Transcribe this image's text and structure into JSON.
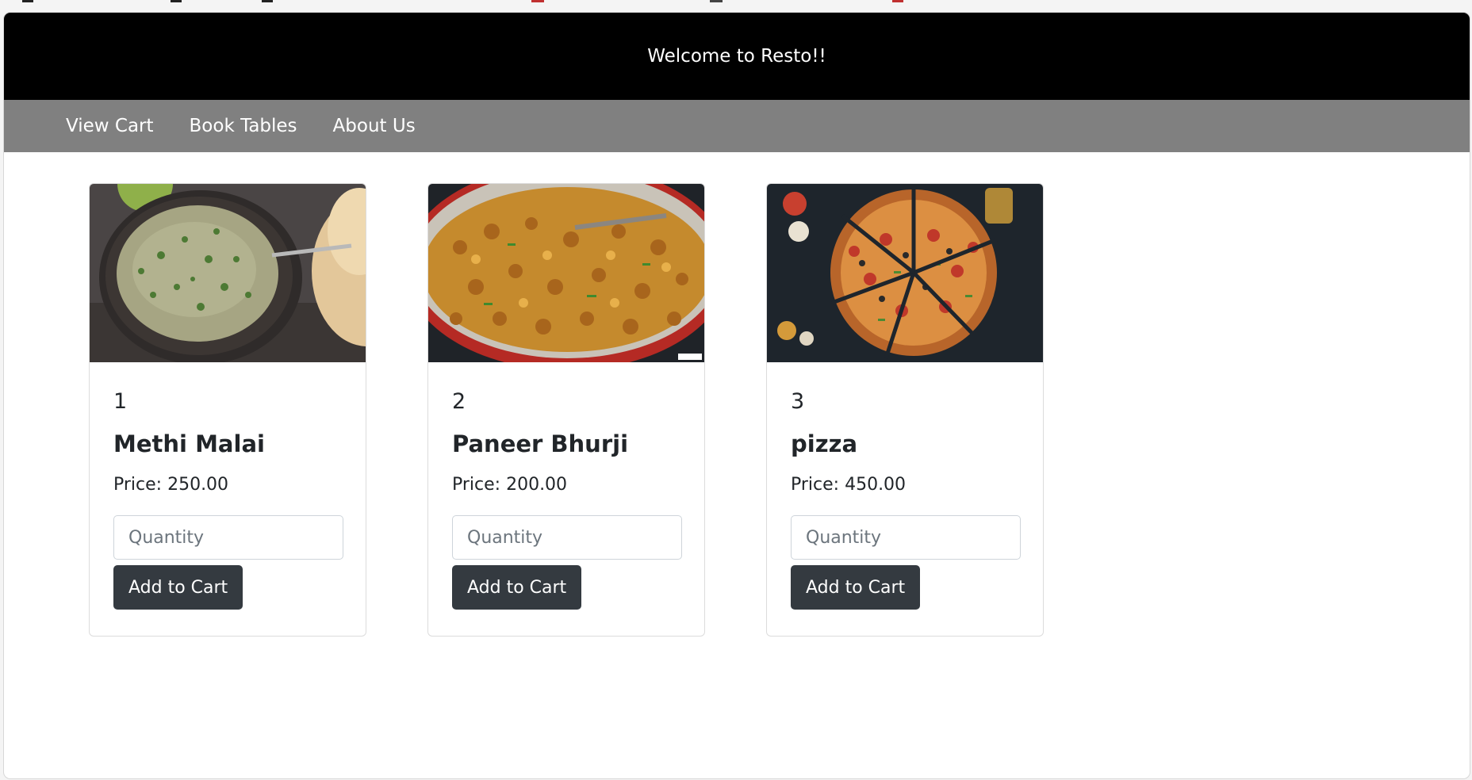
{
  "header": {
    "title": "Welcome to Resto!!",
    "background": "#000000"
  },
  "nav": {
    "items": [
      {
        "label": "View Cart"
      },
      {
        "label": "Book Tables"
      },
      {
        "label": "About Us"
      }
    ],
    "background": "#808080"
  },
  "menu": {
    "quantity_placeholder": "Quantity",
    "add_to_cart_label": "Add to Cart",
    "items": [
      {
        "id": "1",
        "name": "Methi Malai",
        "price": "Price: 250.00",
        "image": "methi-malai-dish"
      },
      {
        "id": "2",
        "name": "Paneer Bhurji",
        "price": "Price: 200.00",
        "image": "paneer-bhurji-dish"
      },
      {
        "id": "3",
        "name": "pizza",
        "price": "Price: 450.00",
        "image": "pizza-dish"
      }
    ]
  },
  "colors": {
    "button": "#343a40",
    "text": "#212529"
  }
}
